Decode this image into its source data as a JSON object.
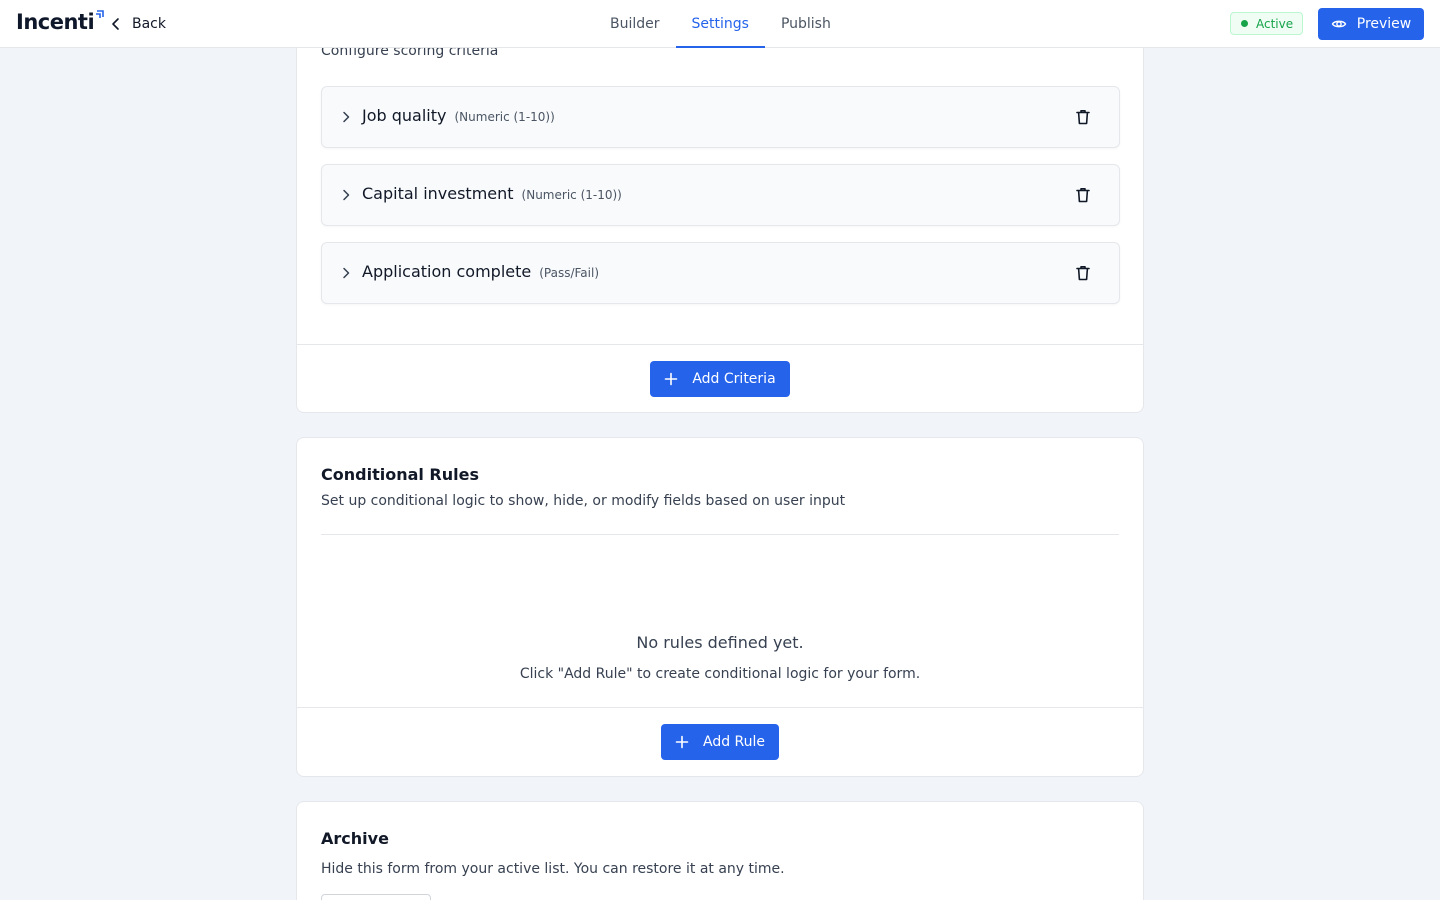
{
  "header": {
    "logo": "Incenti",
    "back_label": "Back",
    "tabs": [
      {
        "label": "Builder",
        "active": false
      },
      {
        "label": "Settings",
        "active": true
      },
      {
        "label": "Publish",
        "active": false
      }
    ],
    "status": "Active",
    "preview_label": "Preview"
  },
  "scoring": {
    "description": "Configure scoring criteria",
    "criteria": [
      {
        "name": "Job quality",
        "type": "(Numeric (1-10))"
      },
      {
        "name": "Capital investment",
        "type": "(Numeric (1-10))"
      },
      {
        "name": "Application complete",
        "type": "(Pass/Fail)"
      }
    ],
    "add_label": "Add Criteria"
  },
  "rules": {
    "title": "Conditional Rules",
    "description": "Set up conditional logic to show, hide, or modify fields based on user input",
    "empty_title": "No rules defined yet.",
    "empty_desc": "Click \"Add Rule\" to create conditional logic for your form.",
    "add_label": "Add Rule"
  },
  "archive": {
    "title": "Archive",
    "description": "Hide this form from your active list. You can restore it at any time."
  },
  "colors": {
    "accent": "#2563eb",
    "success": "#16a34a",
    "background": "#f1f4f8"
  },
  "icons": {
    "logo_mark": "arrow-up-right-icon",
    "back": "chevron-left-icon",
    "preview": "eye-icon",
    "expand": "chevron-right-icon",
    "delete": "trash-icon",
    "add": "plus-icon"
  }
}
